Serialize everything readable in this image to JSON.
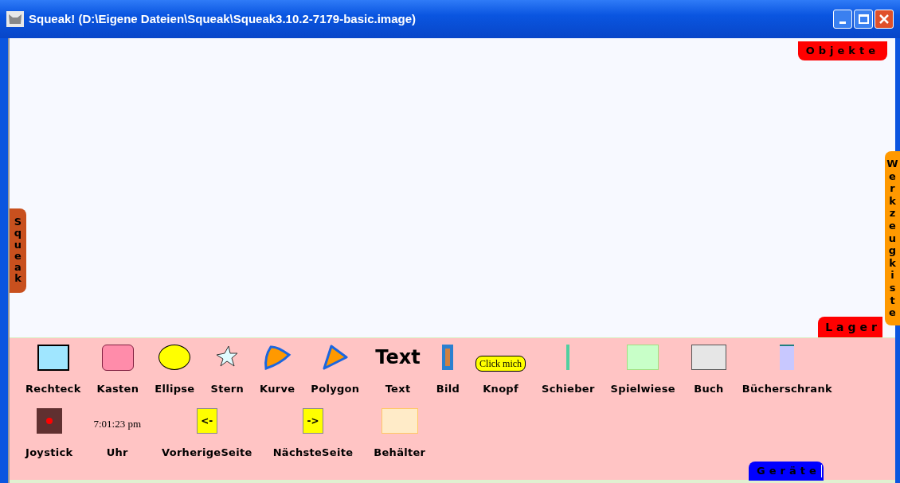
{
  "window": {
    "title": "Squeak! (D:\\Eigene Dateien\\Squeak\\Squeak3.10.2-7179-basic.image)"
  },
  "flaps": [
    {
      "kind": "top-right",
      "label": "Objekte",
      "color": "#ff0000"
    },
    {
      "kind": "left",
      "label": "Squeak",
      "color": "#c8501e"
    },
    {
      "kind": "right",
      "label": "Werkzeugkiste",
      "color": "#ff9900"
    },
    {
      "kind": "above-supplies",
      "label": "Lager",
      "color": "#ff0000"
    },
    {
      "kind": "bottom",
      "label": "Geräte",
      "color": "#0000ff"
    }
  ],
  "supplies": [
    [
      {
        "kind": "rectangle",
        "label": "Rechteck"
      },
      {
        "kind": "box",
        "label": "Kasten"
      },
      {
        "kind": "ellipse",
        "label": "Ellipse"
      },
      {
        "kind": "star",
        "label": "Stern"
      },
      {
        "kind": "curve",
        "label": "Kurve"
      },
      {
        "kind": "polygon",
        "label": "Polygon"
      },
      {
        "kind": "text",
        "sample": "Text",
        "label": "Text"
      },
      {
        "kind": "image",
        "label": "Bild"
      },
      {
        "kind": "button",
        "sample": "Click mich",
        "label": "Knopf"
      },
      {
        "kind": "slider",
        "label": "Schieber"
      },
      {
        "kind": "playfield",
        "label": "Spielwiese"
      },
      {
        "kind": "book",
        "label": "Buch"
      },
      {
        "kind": "bookshelf",
        "label": "Bücherschrank"
      }
    ],
    [
      {
        "kind": "joystick",
        "label": "Joystick"
      },
      {
        "kind": "clock",
        "sample": "7:01:23 pm",
        "label": "Uhr"
      },
      {
        "kind": "prev-page",
        "sample": "<-",
        "label": "VorherigeSeite"
      },
      {
        "kind": "next-page",
        "sample": "->",
        "label": "NächsteSeite"
      },
      {
        "kind": "container",
        "label": "Behälter"
      }
    ]
  ]
}
